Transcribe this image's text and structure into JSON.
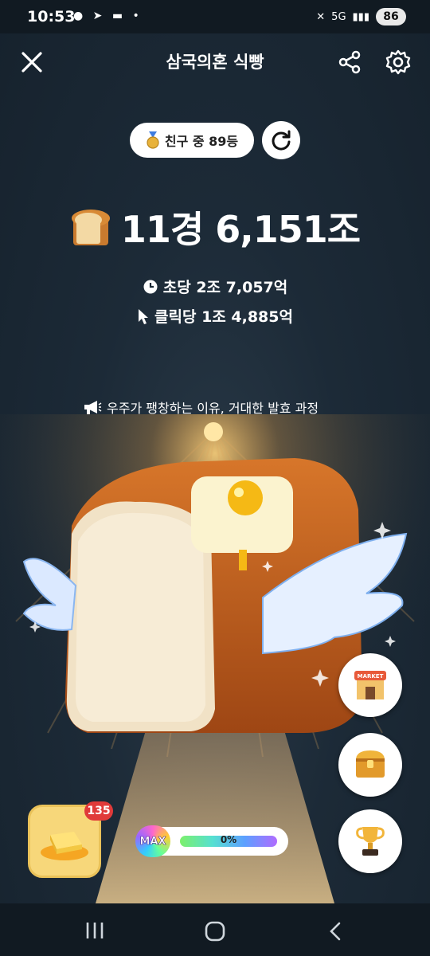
{
  "status_bar": {
    "time": "10:53",
    "battery": "86",
    "network": "5G"
  },
  "header": {
    "title": "삼국의혼 식빵",
    "close_icon": "close-icon",
    "share_icon": "share-icon",
    "settings_icon": "gear-icon"
  },
  "rank": {
    "label": "친구 중 89등",
    "medal_icon": "medal-icon",
    "refresh_icon": "refresh-icon"
  },
  "total": {
    "value": "11경 6,151조",
    "icon": "bread-icon"
  },
  "per_second": {
    "label": "초당 2조 7,057억",
    "icon": "clock-icon"
  },
  "per_click": {
    "label": "클릭당 1조 4,885억",
    "icon": "cursor-icon"
  },
  "notice": {
    "text": "우주가 팽창하는 이유, 거대한 발효 과정",
    "icon": "megaphone-icon"
  },
  "side_buttons": {
    "market": "MARKET",
    "chest_icon": "treasure-chest-icon",
    "trophy_icon": "trophy-icon"
  },
  "butter": {
    "badge": "135",
    "icon": "butter-icon"
  },
  "progress": {
    "max_label": "MAX",
    "percent_text": "0%",
    "percent": 0
  },
  "nav": {
    "recent_icon": "recent-apps-icon",
    "home_icon": "home-icon",
    "back_icon": "back-icon"
  },
  "colors": {
    "background": "#1c2a37",
    "badge_red": "#e03a3a",
    "butter_yellow": "#f7d77a"
  }
}
